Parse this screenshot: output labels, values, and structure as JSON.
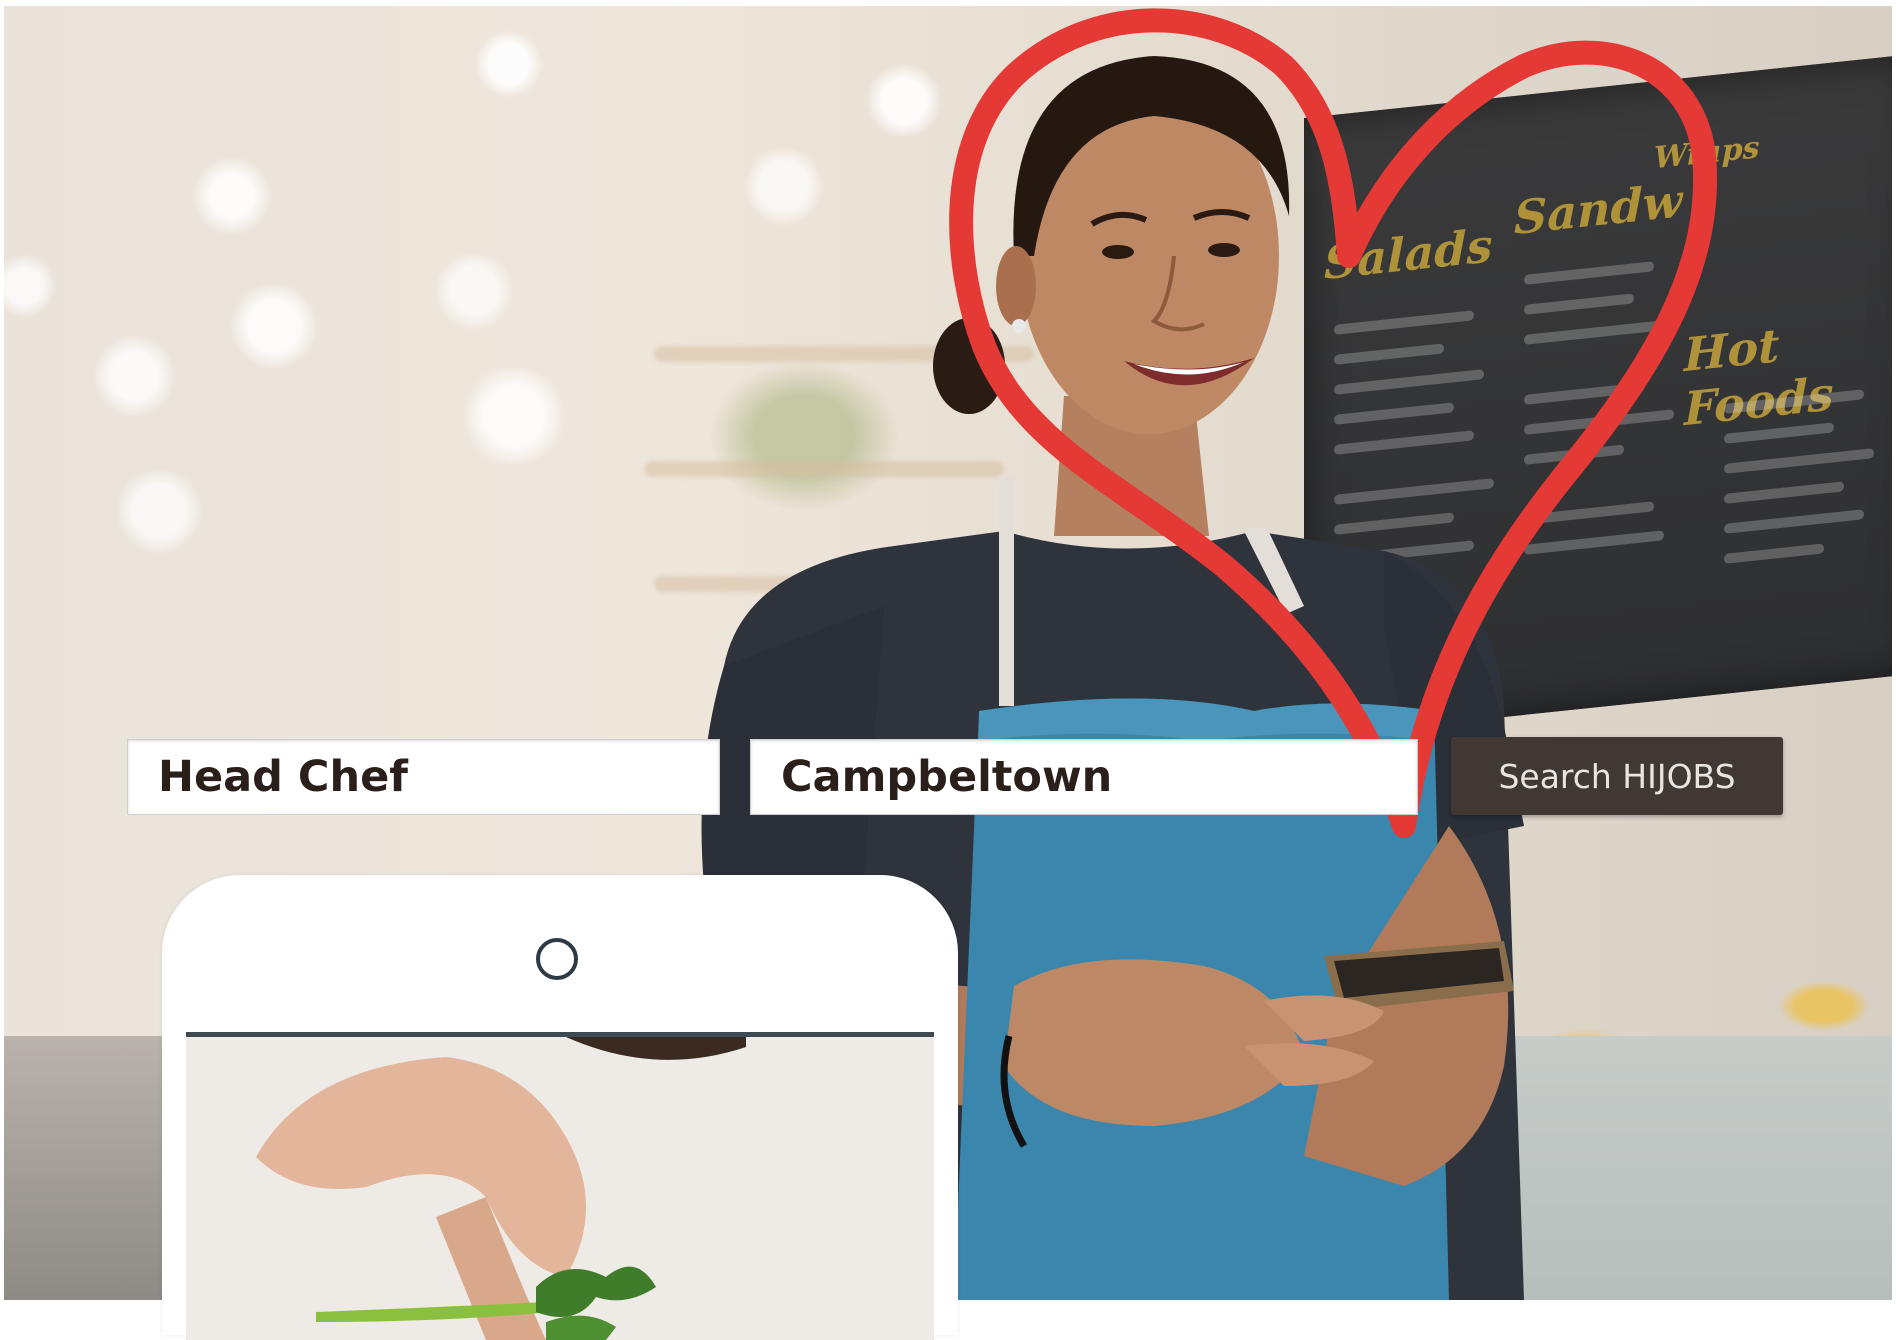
{
  "search": {
    "job_value": "Head Chef",
    "location_value": "Campbeltown",
    "button_label": "Search HIJOBS"
  },
  "colors": {
    "heart": "#e53935",
    "button_bg": "#3f3833",
    "apron": "#3a86ad"
  },
  "icons": {
    "heart": "heart-icon",
    "camera": "phone-camera-icon"
  }
}
